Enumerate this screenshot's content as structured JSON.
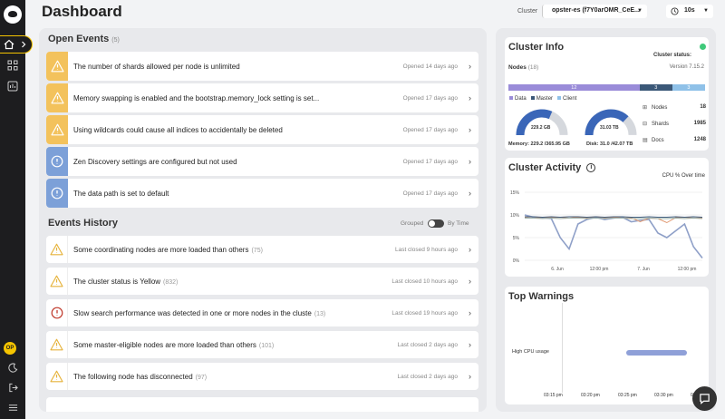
{
  "header": {
    "title": "Dashboard",
    "cluster_label": "Cluster",
    "cluster_value": "opster-es (f7Y0arOMR_CeE...",
    "refresh_value": "10s"
  },
  "sidebar": {
    "avatar_initials": "OP"
  },
  "open_events": {
    "title": "Open Events",
    "count": "(5)",
    "items": [
      {
        "message": "The number of shards allowed per node is unlimited",
        "time": "Opened 14 days ago",
        "severity": "warning"
      },
      {
        "message": "Memory swapping is enabled and the bootstrap.memory_lock setting is set...",
        "time": "Opened 17 days ago",
        "severity": "warning"
      },
      {
        "message": "Using wildcards could cause all indices to accidentally be deleted",
        "time": "Opened 17 days ago",
        "severity": "warning"
      },
      {
        "message": "Zen Discovery settings are configured but not used",
        "time": "Opened 17 days ago",
        "severity": "info"
      },
      {
        "message": "The data path is set to default",
        "time": "Opened 17 days ago",
        "severity": "info"
      }
    ]
  },
  "events_history": {
    "title": "Events History",
    "grouped_label": "Grouped",
    "bytime_label": "By Time",
    "items": [
      {
        "message": "Some coordinating nodes are more loaded than others",
        "count": "(75)",
        "time": "Last closed 9 hours ago",
        "severity": "warning"
      },
      {
        "message": "The cluster status is Yellow",
        "count": "(832)",
        "time": "Last closed 10 hours ago",
        "severity": "warning"
      },
      {
        "message": "Slow search performance was detected in one or more nodes in the cluste",
        "count": "(13)",
        "time": "Last closed 19 hours ago",
        "severity": "error"
      },
      {
        "message": "Some master-eligible nodes are more loaded than others",
        "count": "(101)",
        "time": "Last closed 2 days ago",
        "severity": "warning"
      },
      {
        "message": "The following node has disconnected",
        "count": "(97)",
        "time": "Last closed 2 days ago",
        "severity": "warning"
      }
    ]
  },
  "cluster_info": {
    "title": "Cluster Info",
    "status_label": "Cluster status:",
    "status_color": "#3fc97a",
    "nodes_label": "Nodes",
    "nodes_count": "(18)",
    "version": "Version 7.15.2",
    "bar": [
      {
        "label": "12",
        "value": 12,
        "color": "#9a8cd9"
      },
      {
        "label": "3",
        "value": 3,
        "color": "#3b5878"
      },
      {
        "label": "3",
        "value": 3,
        "color": "#8fc1e8"
      }
    ],
    "legend": [
      {
        "label": "Data",
        "color": "#9a8cd9"
      },
      {
        "label": "Master",
        "color": "#3b5878"
      },
      {
        "label": "Client",
        "color": "#8fc1e8"
      }
    ],
    "memory_gauge": {
      "label": "229.2 GB",
      "fraction": 0.63
    },
    "disk_gauge": {
      "label": "31.03 TB",
      "fraction": 0.74
    },
    "memory_text": "Memory: 229.2 /365.95 GB",
    "disk_text": "Disk: 31.0 /42.07 TB",
    "stats": [
      {
        "label": "Nodes",
        "value": "18"
      },
      {
        "label": "Shards",
        "value": "1985"
      },
      {
        "label": "Docs",
        "value": "1248"
      }
    ]
  },
  "cluster_activity": {
    "title": "Cluster Activity",
    "subtitle": "CPU % Over time"
  },
  "chart_data": {
    "type": "line",
    "title": "Cluster Activity",
    "subtitle": "CPU % Over time",
    "x": [
      "6. Jun",
      "12:00 pm",
      "7. Jun",
      "12:00 pm"
    ],
    "ylim": [
      0,
      15
    ],
    "yticks": [
      "0%",
      "5%",
      "10%",
      "15%"
    ],
    "series": [
      {
        "color": "#8fa0c8",
        "values": [
          10,
          9.5,
          9.4,
          9.2,
          5,
          2.5,
          8,
          9,
          9.5,
          9,
          9.3,
          9.5,
          8.5,
          8.8,
          9,
          6,
          5,
          6.5,
          8,
          3,
          0.5
        ]
      },
      {
        "color": "#e09870",
        "values": [
          9.4,
          9.3,
          9.5,
          9.4,
          9.5,
          9.3,
          9.5,
          9.4,
          9.6,
          9.4,
          9.5,
          9.3,
          9.4,
          8.5,
          9.3,
          9.2,
          8.3,
          9.4,
          9.5,
          9.3,
          9.4
        ]
      },
      {
        "color": "#3b5878",
        "values": [
          9.6,
          9.6,
          9.5,
          9.6,
          9.5,
          9.6,
          9.6,
          9.5,
          9.6,
          9.5,
          9.6,
          9.6,
          9.5,
          9.5,
          9.6,
          9.5,
          9.5,
          9.6,
          9.5,
          9.6,
          9.5
        ]
      },
      {
        "color": "#9ab0a8",
        "values": [
          9.3,
          9.3,
          9.2,
          9.3,
          9.2,
          9.3,
          9.3,
          9.2,
          9.3,
          9.2,
          9.3,
          9.3,
          9.2,
          9.2,
          9.3,
          9.2,
          9.2,
          9.3,
          9.2,
          9.3,
          9.2
        ]
      }
    ]
  },
  "top_warnings": {
    "title": "Top Warnings",
    "row_label": "High CPU usage",
    "bar_color": "#8fa0d8",
    "times": [
      "03:15 pm",
      "03:20 pm",
      "03:25 pm",
      "03:30 pm",
      "03:35 pm"
    ]
  }
}
